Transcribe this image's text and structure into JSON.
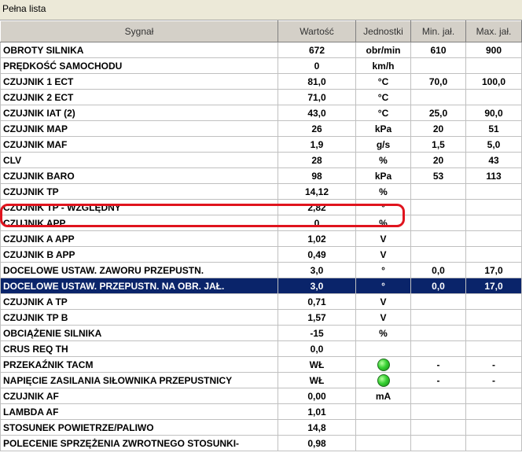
{
  "window": {
    "title": "Pełna lista"
  },
  "columns": [
    "Sygnał",
    "Wartość",
    "Jednostki",
    "Min. jał.",
    "Max. jał."
  ],
  "rows": [
    {
      "signal": "OBROTY SILNIKA",
      "value": "672",
      "unit": "obr/min",
      "min": "610",
      "max": "900"
    },
    {
      "signal": "PRĘDKOŚĆ SAMOCHODU",
      "value": "0",
      "unit": "km/h",
      "min": "",
      "max": ""
    },
    {
      "signal": "CZUJNIK 1 ECT",
      "value": "81,0",
      "unit": "°C",
      "min": "70,0",
      "max": "100,0"
    },
    {
      "signal": "CZUJNIK 2 ECT",
      "value": "71,0",
      "unit": "°C",
      "min": "",
      "max": ""
    },
    {
      "signal": "CZUJNIK IAT (2)",
      "value": "43,0",
      "unit": "°C",
      "min": "25,0",
      "max": "90,0"
    },
    {
      "signal": "CZUJNIK MAP",
      "value": "26",
      "unit": "kPa",
      "min": "20",
      "max": "51"
    },
    {
      "signal": "CZUJNIK MAF",
      "value": "1,9",
      "unit": "g/s",
      "min": "1,5",
      "max": "5,0"
    },
    {
      "signal": "CLV",
      "value": "28",
      "unit": "%",
      "min": "20",
      "max": "43"
    },
    {
      "signal": "CZUJNIK BARO",
      "value": "98",
      "unit": "kPa",
      "min": "53",
      "max": "113"
    },
    {
      "signal": "CZUJNIK TP",
      "value": "14,12",
      "unit": "%",
      "min": "",
      "max": ""
    },
    {
      "signal": "CZUJNIK TP - WZGLĘDNY",
      "value": "2,82",
      "unit": "°",
      "min": "",
      "max": ""
    },
    {
      "signal": "CZUJNIK APP",
      "value": "0",
      "unit": "%",
      "min": "",
      "max": ""
    },
    {
      "signal": "CZUJNIK A APP",
      "value": "1,02",
      "unit": "V",
      "min": "",
      "max": ""
    },
    {
      "signal": "CZUJNIK B APP",
      "value": "0,49",
      "unit": "V",
      "min": "",
      "max": ""
    },
    {
      "signal": "DOCELOWE USTAW. ZAWORU PRZEPUSTN.",
      "value": "3,0",
      "unit": "°",
      "min": "0,0",
      "max": "17,0"
    },
    {
      "signal": "DOCELOWE USTAW. PRZEPUSTN. NA OBR. JAŁ.",
      "value": "3,0",
      "unit": "°",
      "min": "0,0",
      "max": "17,0"
    },
    {
      "signal": "CZUJNIK A TP",
      "value": "0,71",
      "unit": "V",
      "min": "",
      "max": ""
    },
    {
      "signal": "CZUJNIK TP B",
      "value": "1,57",
      "unit": "V",
      "min": "",
      "max": ""
    },
    {
      "signal": "OBCIĄŻENIE SILNIKA",
      "value": "-15",
      "unit": "%",
      "min": "",
      "max": ""
    },
    {
      "signal": "CRUS REQ TH",
      "value": "0,0",
      "unit": "",
      "min": "",
      "max": ""
    },
    {
      "signal": "PRZEKAŹNIK TACM",
      "value": "WŁ",
      "unit": "",
      "indicator": "green-led",
      "min": "-",
      "max": "-"
    },
    {
      "signal": "NAPIĘCIE ZASILANIA SIŁOWNIKA PRZEPUSTNICY",
      "value": "WŁ",
      "unit": "",
      "indicator": "green-led",
      "min": "-",
      "max": "-"
    },
    {
      "signal": "CZUJNIK AF",
      "value": "0,00",
      "unit": "mA",
      "min": "",
      "max": ""
    },
    {
      "signal": "LAMBDA AF",
      "value": "1,01",
      "unit": "",
      "min": "",
      "max": ""
    },
    {
      "signal": "STOSUNEK POWIETRZE/PALIWO",
      "value": "14,8",
      "unit": "",
      "min": "",
      "max": ""
    },
    {
      "signal": "POLECENIE SPRZĘŻENIA ZWROTNEGO STOSUNKI-",
      "value": "0,98",
      "unit": "",
      "min": "",
      "max": ""
    }
  ],
  "selected_row": 15,
  "highlighted_row": 10,
  "colors": {
    "selection": "#0a246a",
    "highlight_outline": "#e0141e",
    "min_text": "#1a2c6b",
    "max_text": "#7a0a0a",
    "led": "#38d234"
  }
}
